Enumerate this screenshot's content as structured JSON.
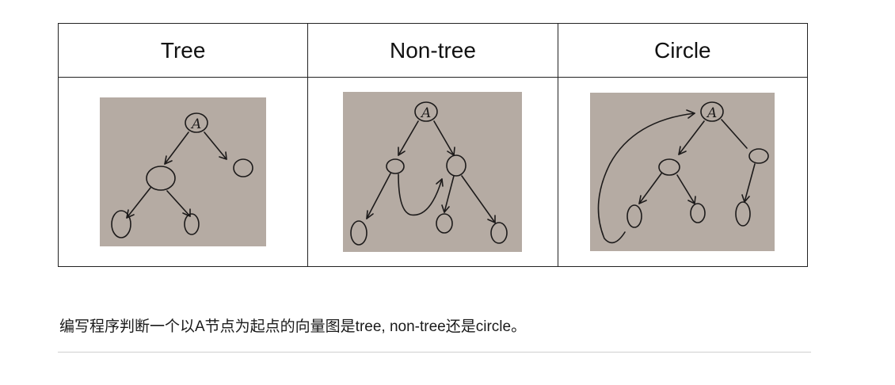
{
  "table": {
    "headers": [
      "Tree",
      "Non-tree",
      "Circle"
    ],
    "photos": [
      {
        "node_label": "A",
        "icon": "tree-graph-sketch-icon",
        "background": "#b5aba3"
      },
      {
        "node_label": "A",
        "icon": "non-tree-graph-sketch-icon",
        "background": "#b5aba3"
      },
      {
        "node_label": "A",
        "icon": "cyclic-graph-sketch-icon",
        "background": "#b5aba3"
      }
    ]
  },
  "question": "编写程序判断一个以A节点为起点的向量图是tree, non-tree还是circle。",
  "colors": {
    "border": "#222222",
    "rule": "#cfcfcf",
    "ink": "#1c1a1a"
  }
}
